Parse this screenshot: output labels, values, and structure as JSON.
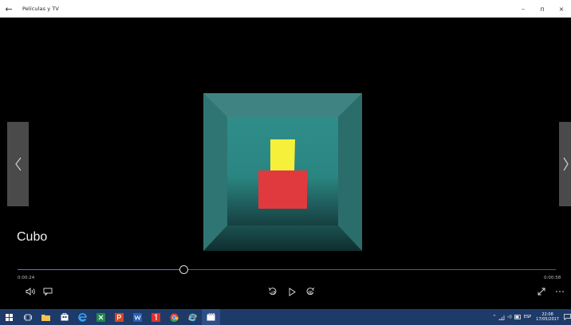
{
  "window": {
    "title": "Películas y TV",
    "back_glyph": "←",
    "minimize_glyph": "–",
    "maximize_glyph": "ᴨ",
    "close_glyph": "×"
  },
  "player": {
    "caption": "Cubo",
    "current_time": "0:00:24",
    "total_time": "0:00:58",
    "progress_fraction": 0.31
  },
  "icons": {
    "back": "back-arrow-icon",
    "prev": "chevron-left-icon",
    "next": "chevron-right-icon",
    "volume": "volume-icon",
    "subtitles": "subtitles-icon",
    "skip_back": "skip-back-10-icon",
    "play": "play-icon",
    "skip_forward": "skip-forward-30-icon",
    "fullscreen": "fullscreen-icon",
    "more": "more-icon"
  },
  "taskbar": {
    "apps": [
      "windows-start-icon",
      "task-view-icon",
      "file-explorer-icon",
      "store-icon",
      "edge-icon",
      "excel-icon",
      "powerpoint-icon",
      "word-icon",
      "red-app-icon",
      "chrome-icon",
      "internet-explorer-icon",
      "movies-tv-icon"
    ],
    "tray": {
      "language": "ESP",
      "time": "22:08",
      "date": "17/05/2017"
    }
  },
  "colors": {
    "accent": "#4f79d8",
    "taskbar": "#1e3a68",
    "cube_face": "#2f8b86",
    "yellow_block": "#f6f03a",
    "red_block": "#e03a3f"
  }
}
